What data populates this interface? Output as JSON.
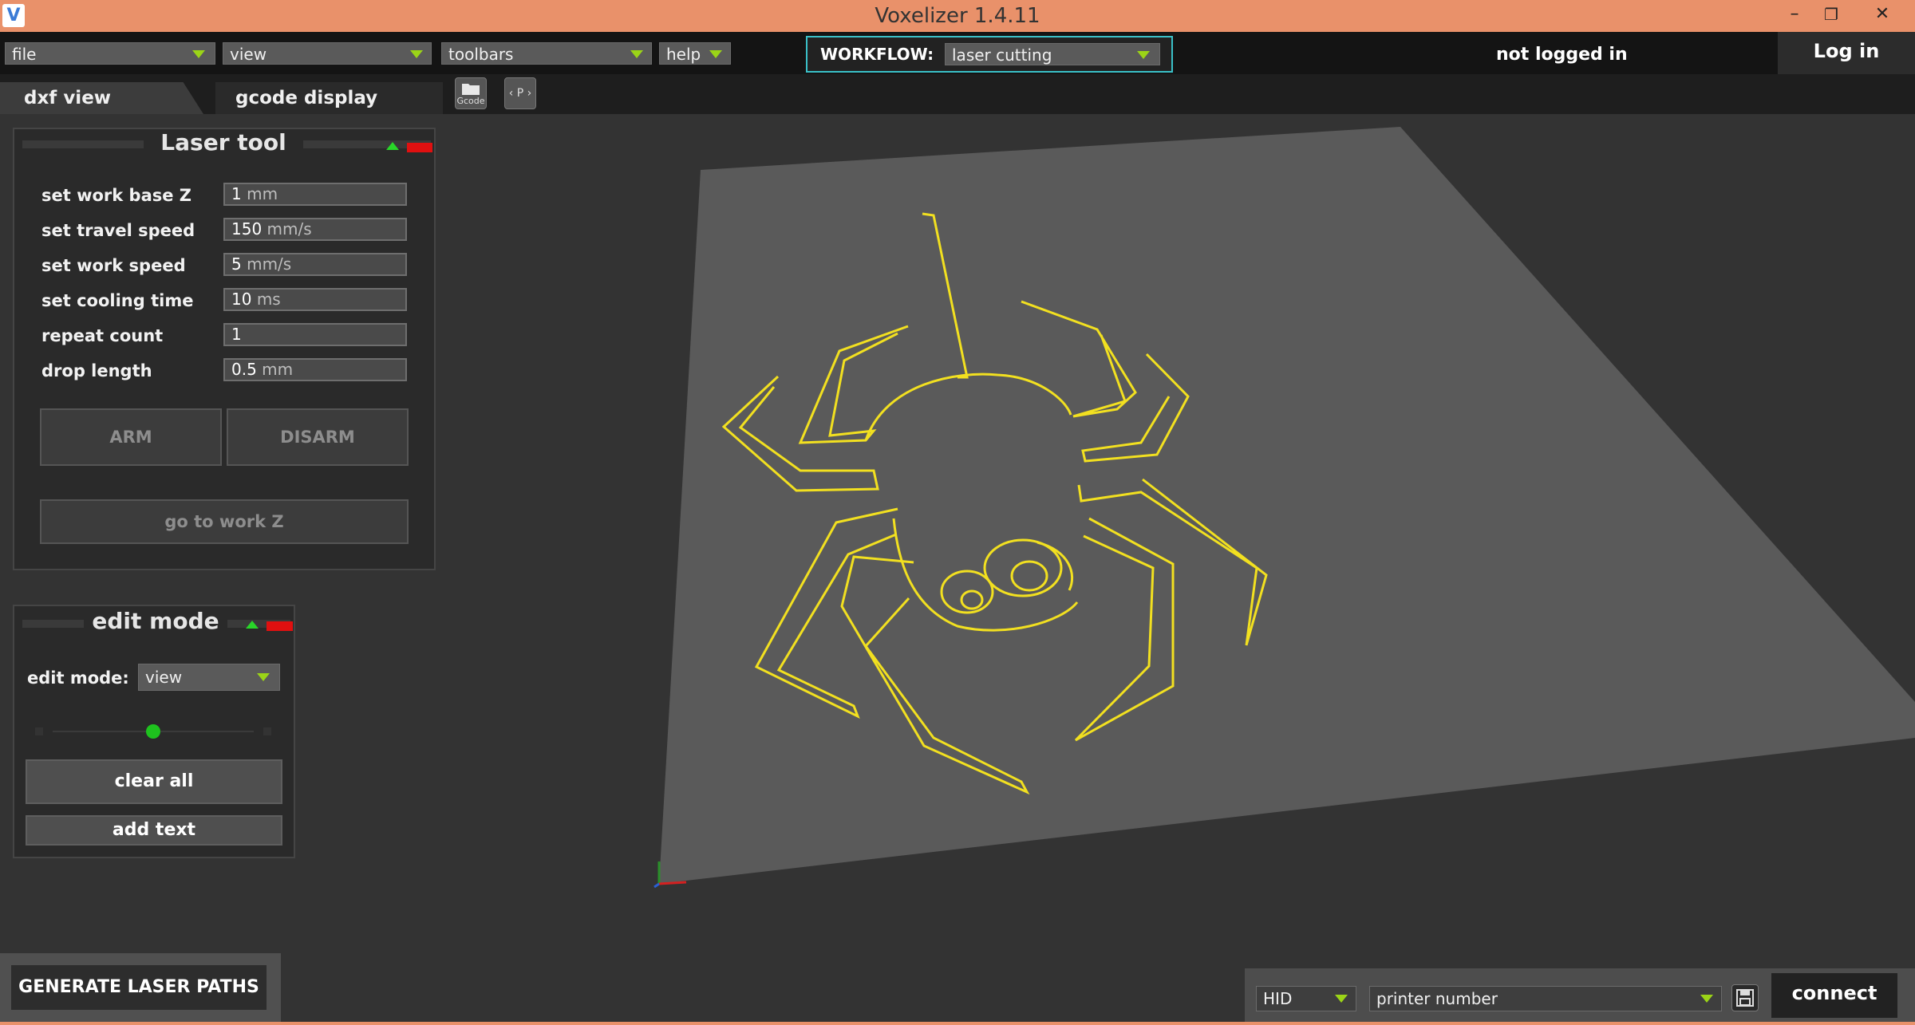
{
  "window": {
    "title": "Voxelizer 1.4.11",
    "logo_letter": "V",
    "minimize": "–",
    "maximize": "❐",
    "close": "✕"
  },
  "menubar": {
    "file": "file",
    "view": "view",
    "toolbars": "toolbars",
    "help": "help",
    "workflow_label": "WORKFLOW:",
    "workflow_value": "laser cutting",
    "login_status": "not logged in",
    "login_button": "Log in"
  },
  "tabs": {
    "dxf": "dxf view",
    "gcode": "gcode display"
  },
  "toolbar_icons": {
    "gcode_icon": "gcode-folder-icon",
    "gcode_label": "Gcode",
    "p_icon": "P"
  },
  "laser_tool": {
    "title": "Laser tool",
    "rows": [
      {
        "label": "set work base Z",
        "value": "1",
        "unit": "mm"
      },
      {
        "label": "set travel speed",
        "value": "150",
        "unit": "mm/s"
      },
      {
        "label": "set work speed",
        "value": "5",
        "unit": "mm/s"
      },
      {
        "label": "set cooling time",
        "value": "10",
        "unit": "ms"
      },
      {
        "label": "repeat count",
        "value": "1",
        "unit": ""
      },
      {
        "label": "drop length",
        "value": "0.5",
        "unit": "mm"
      }
    ],
    "arm": "ARM",
    "disarm": "DISARM",
    "go_to_work_z": "go to work Z"
  },
  "edit_mode": {
    "title": "edit mode",
    "label": "edit mode:",
    "value": "view",
    "slider_value": 0.5,
    "clear_all": "clear all",
    "add_text": "add text"
  },
  "bottom": {
    "generate": "GENERATE LASER PATHS",
    "port": "HID",
    "printer_placeholder": "printer number",
    "connect": "connect"
  },
  "colors": {
    "titlebar": "#e9916a",
    "accent": "#3ac0c8",
    "dropdown_arrow": "#9bd417",
    "spider": "#f2e020",
    "plate": "#5a5a5a"
  }
}
